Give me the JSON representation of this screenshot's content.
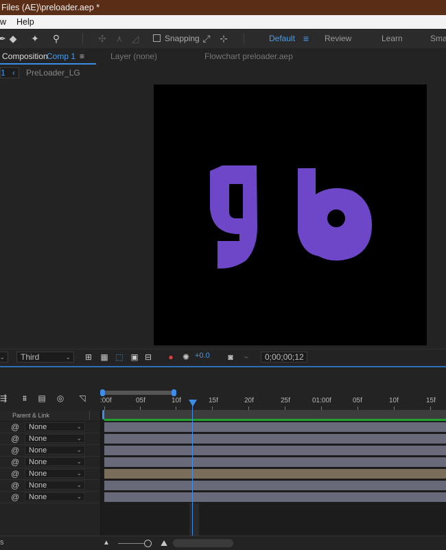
{
  "title_bar": {
    "text": "Files (AE)\\preloader.aep *"
  },
  "menu": {
    "items": [
      "w",
      "Help"
    ]
  },
  "toolbar": {
    "snapping_label": "Snapping",
    "workspaces": [
      "Default",
      "Review",
      "Learn",
      "Smal"
    ],
    "active_workspace": "Default"
  },
  "panel_header": {
    "composition_tab_label": "Composition",
    "composition_name": "Comp 1",
    "menu_icon": "≡",
    "layer_tab": "Layer  (none)",
    "flowchart_tab": "Flowchart  preloader.aep"
  },
  "comp_nav": {
    "index_fragment": "1",
    "breadcrumb": "PreLoader_LG"
  },
  "viewer": {
    "logo_text": "gb",
    "logo_color": "#6e46c8"
  },
  "viewer_controls": {
    "view_select": "Third",
    "exposure_value": "+0.0",
    "timecode": "0;00;00;12"
  },
  "timeline": {
    "ruler_labels": [
      ":00f",
      "05f",
      "10f",
      "15f",
      "20f",
      "25f",
      "01:00f",
      "05f",
      "10f",
      "15f"
    ],
    "column_header": "Parent & Link",
    "parent_values": [
      "None",
      "None",
      "None",
      "None",
      "None",
      "None",
      "None"
    ]
  },
  "colors": {
    "accent": "#3d8ee8",
    "title_bar": "#5a2d16",
    "workspace_active": "#4a9de8",
    "track_bar": "#686a7a",
    "track_bar_highlight": "#7a6e5a",
    "green_marker": "#1fa22e"
  }
}
